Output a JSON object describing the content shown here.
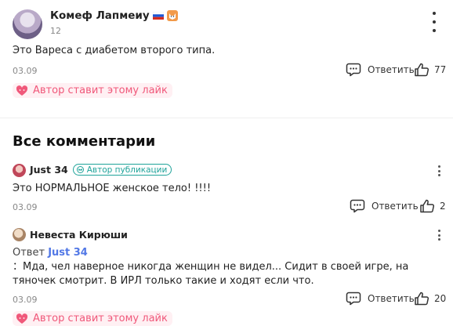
{
  "top_comment": {
    "username": "Комеф Лапмеиу",
    "level": "12",
    "text": "Это Вареса с диабетом второго типа.",
    "date": "03.09",
    "reply_label": "Ответить",
    "likes": "77",
    "author_like": "Автор ставит этому лайк"
  },
  "section_title": "Все комментарии",
  "comments": [
    {
      "username": "Just 34",
      "badge": "Автор публикации",
      "text": "Это НОРМАЛЬНОЕ женское тело! !!!!",
      "date": "03.09",
      "reply_label": "Ответить",
      "likes": "2"
    },
    {
      "username": "Невеста Кирюши",
      "reply_prefix": "Ответ",
      "reply_to": "Just 34",
      "text": "：Мда, чел наверное никогда женщин не видел... Сидит в своей игре, на тяночек смотрит. В ИРЛ только такие и ходят если что.",
      "date": "03.09",
      "reply_label": "Ответить",
      "likes": "20",
      "author_like": "Автор ставит этому лайк"
    }
  ],
  "colors": {
    "accent_pink": "#f0587a",
    "pink_bg": "#fff0f3",
    "author_badge": "#1fa39a",
    "mention_blue": "#5278e6"
  }
}
